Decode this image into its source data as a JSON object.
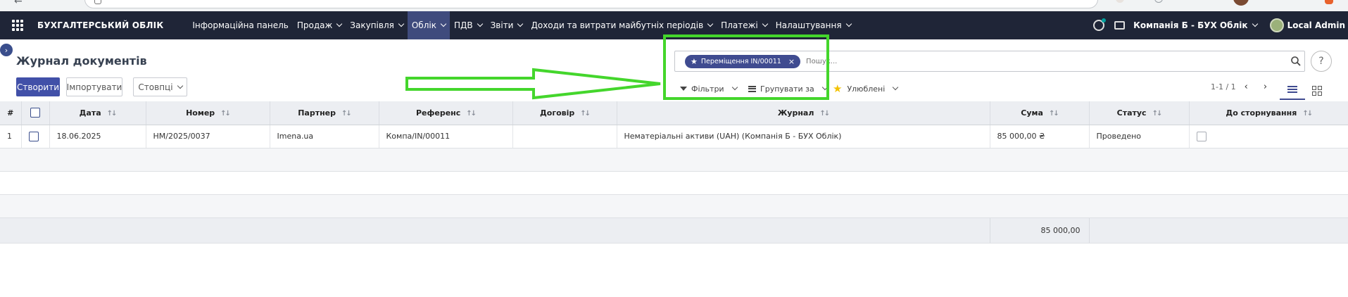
{
  "navbar": {
    "brand": "БУХГАЛТЕРСЬКИЙ ОБЛІК",
    "menu": [
      {
        "label": "Інформаційна панель",
        "dropdown": false
      },
      {
        "label": "Продаж",
        "dropdown": true
      },
      {
        "label": "Закупівля",
        "dropdown": true
      },
      {
        "label": "Облік",
        "dropdown": true,
        "active": true
      },
      {
        "label": "ПДВ",
        "dropdown": true
      },
      {
        "label": "Звіти",
        "dropdown": true
      },
      {
        "label": "Доходи та витрати майбутніх періодів",
        "dropdown": true
      },
      {
        "label": "Платежі",
        "dropdown": true
      },
      {
        "label": "Налаштування",
        "dropdown": true
      }
    ],
    "company": "Компанія Б - БУХ Облік",
    "user": "Local Admin"
  },
  "control_panel": {
    "title": "Журнал документів",
    "create_label": "Створити",
    "import_label": "Імпортувати",
    "columns_label": "Стовпці",
    "search": {
      "facet_label": "Переміщення IN/00011",
      "placeholder": "Пошук..."
    },
    "filters_label": "Фільтри",
    "group_by_label": "Групувати за",
    "favorites_label": "Улюблені",
    "pager": "1-1 / 1",
    "help": "?"
  },
  "table": {
    "headers": [
      "#",
      "",
      "Дата",
      "Номер",
      "Партнер",
      "Референс",
      "Договір",
      "Журнал",
      "Сума",
      "Статус",
      "До сторнування"
    ],
    "rows": [
      {
        "index": "1",
        "date": "18.06.2025",
        "number": "НМ/2025/0037",
        "partner": "Imena.ua",
        "reference": "Компа/IN/00011",
        "contract": "",
        "journal": "Нематеріальні активи (UAH) (Компанія Б - БУХ Облік)",
        "amount": "85 000,00 ₴",
        "status": "Проведено"
      }
    ],
    "total_amount": "85 000,00"
  },
  "colors": {
    "navbar": "#1f2537",
    "primary": "#4150a8",
    "annotation": "#44d62c"
  }
}
